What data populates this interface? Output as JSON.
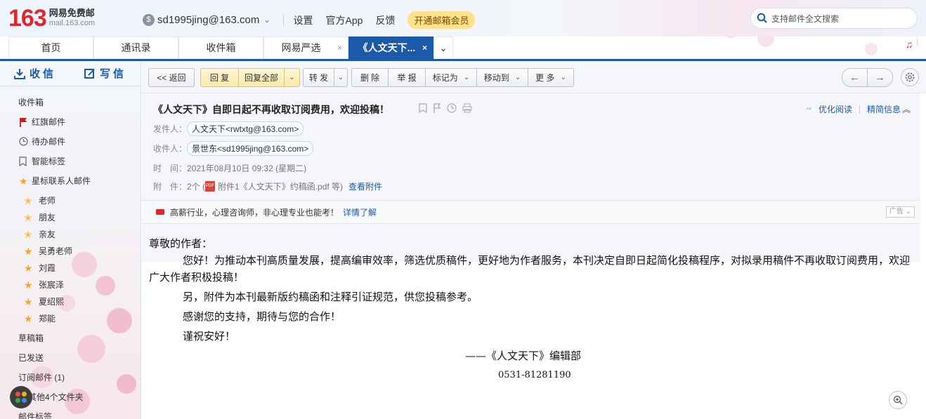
{
  "brand": {
    "logo_number": "163",
    "logo_name": "网易免费邮",
    "logo_domain": "mail.163.com",
    "accent_color": "#1a5aa8",
    "logo_color": "#e0262d"
  },
  "topbar": {
    "account": "sd1995jing@163.com",
    "links": [
      "设置",
      "官方App",
      "反馈"
    ],
    "vip_button": "开通邮箱会员",
    "search_placeholder": "支持邮件全文搜索"
  },
  "tabs": [
    {
      "label": "首页"
    },
    {
      "label": "通讯录"
    },
    {
      "label": "收件箱"
    },
    {
      "label": "网易严选",
      "close": "×"
    },
    {
      "label": "《人文天下...",
      "close": "×"
    }
  ],
  "sidebar": {
    "receive": "收信",
    "compose": "写信",
    "items": [
      "收件箱",
      "红旗邮件",
      "待办邮件",
      "智能标签",
      "星标联系人邮件"
    ],
    "starred": [
      "老师",
      "朋友",
      "亲友",
      "吴勇老师",
      "刘霞",
      "张宸泽",
      "夏绍熙",
      "郑能"
    ],
    "items2": [
      "草稿箱",
      "已发送",
      "订阅邮件 (1)",
      "其他4个文件夹",
      "邮件标签"
    ]
  },
  "toolbar": {
    "back": "<< 返回",
    "reply": "回 复",
    "reply_all": "回复全部",
    "forward": "转 发",
    "delete": "删 除",
    "report": "举 报",
    "mark_as": "标记为",
    "move_to": "移动到",
    "more": "更 多"
  },
  "mail": {
    "subject": "《人文天下》自即日起不再收取订阅费用，欢迎投稿！",
    "optimize_read": "优化阅读",
    "brief_info": "精简信息",
    "sender_label": "发件人：",
    "sender": "人文天下<rwtxtg@163.com>",
    "recipient_label": "收件人：",
    "recipient": "景世东<sd1995jing@163.com>",
    "time_label": "时　间：",
    "time": "2021年08月10日 09:32 (星期二)",
    "attach_label": "附　件：",
    "attach_count": "2个 (",
    "attach_name": "附件1《人文天下》约稿函.pdf 等)",
    "view_attach": "查看附件"
  },
  "ad": {
    "text": "高薪行业，心理咨询师，非心理专业也能考！",
    "link": "详情了解",
    "tag": "广告"
  },
  "body": {
    "greeting": "尊敬的作者：",
    "p1": "您好！为推动本刊高质量发展，提高编审效率，筛选优质稿件，更好地为作者服务，本刊决定自即日起简化投稿程序，对拟录用稿件不再收取订阅费用，欢迎广大作者积极投稿！",
    "p2": "另，附件为本刊最新版约稿函和注释引证规范，供您投稿参考。",
    "p3": "感谢您的支持，期待与您的合作！",
    "p4": "谨祝安好！",
    "signature": "——《人文天下》编辑部",
    "phone": "0531-81281190"
  }
}
